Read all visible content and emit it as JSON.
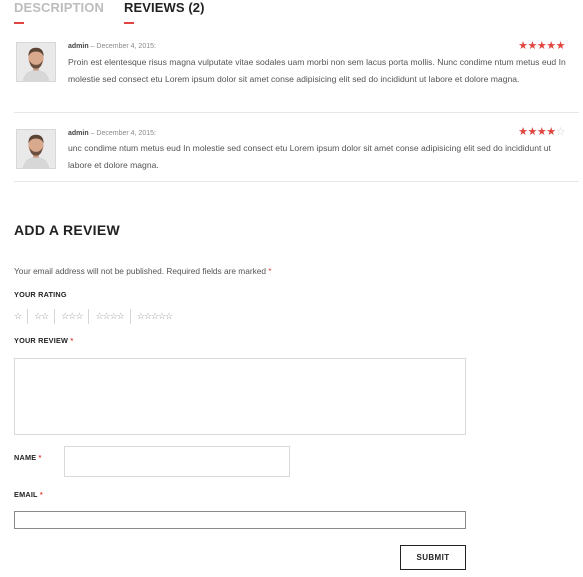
{
  "tabs": [
    {
      "label": "DESCRIPTION",
      "active": false
    },
    {
      "label": "REVIEWS (2)",
      "active": true
    }
  ],
  "reviews": [
    {
      "author": "admin",
      "date": "– December 4, 2015:",
      "rating": 5,
      "text": "Proin est elentesque risus magna vulputate vitae sodales uam morbi non sem lacus porta mollis. Nunc condime ntum metus eud In molestie sed consect etu Lorem ipsum dolor sit amet conse adipisicing elit sed do incididunt ut labore et dolore magna."
    },
    {
      "author": "admin",
      "date": "– December 4, 2015:",
      "rating": 4,
      "text": "unc condime ntum metus eud In molestie sed consect etu Lorem ipsum dolor sit amet conse adipisicing elit sed do incididunt ut labore et dolore magna."
    }
  ],
  "add_review": {
    "title": "ADD A REVIEW",
    "notice": "Your email address will not be published. Required fields are marked",
    "required_mark": "*",
    "rating_label": "YOUR RATING",
    "rating_options": [
      "☆",
      "☆☆",
      "☆☆☆",
      "☆☆☆☆",
      "☆☆☆☆☆"
    ],
    "review_label": "YOUR REVIEW",
    "name_label": "NAME",
    "email_label": "EMAIL",
    "submit_label": "SUBMIT"
  },
  "colors": {
    "accent": "#e0463f",
    "star_off": "#cfcfcf",
    "border": "#d9d9d9"
  }
}
